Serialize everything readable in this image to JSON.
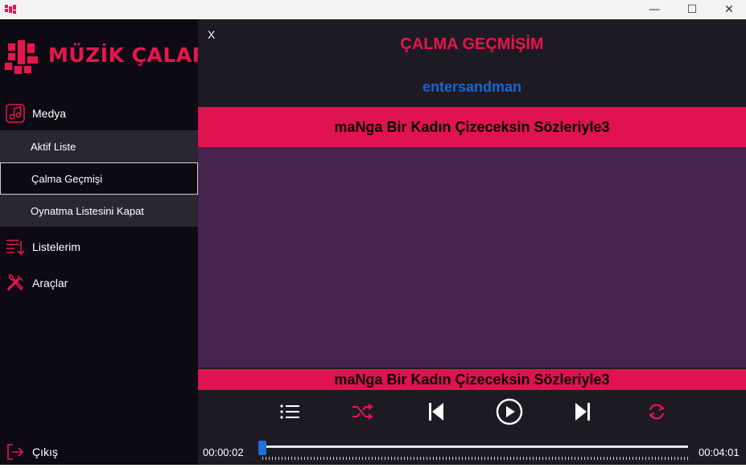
{
  "window": {
    "minimize_glyph": "—",
    "maximize_glyph": "☐",
    "close_glyph": "✕"
  },
  "sidebar": {
    "logo_text": "MÜZİK ÇALAR",
    "media_label": "Medya",
    "sub_items": [
      {
        "label": "Aktif Liste"
      },
      {
        "label": "Çalma Geçmişi"
      },
      {
        "label": "Oynatma Listesini Kapat"
      }
    ],
    "playlists_label": "Listelerim",
    "tools_label": "Araçlar",
    "exit_label": "Çıkış"
  },
  "main": {
    "close_label": "X",
    "page_title": "ÇALMA GEÇMİŞİM",
    "artist": "entersandman",
    "list_header": "maNga Bir Kadın Çizeceksin Sözleriyle3",
    "now_playing": "maNga Bir Kadın Çizeceksin Sözleriyle3"
  },
  "player": {
    "elapsed": "00:00:02",
    "total": "00:04:01",
    "progress_fraction": 0.008
  },
  "icons": {
    "playlist": "list-icon",
    "shuffle": "shuffle-icon",
    "previous": "skip-back-icon",
    "play": "play-circle-icon",
    "next": "skip-forward-icon",
    "repeat": "repeat-icon"
  },
  "colors": {
    "accent": "#e0124f",
    "sidebar_bg": "#0d0a14",
    "main_bg": "#1d1a23",
    "list_bg": "#46244e",
    "artist_blue": "#1566d6",
    "seek_blue": "#1e6fd9"
  }
}
